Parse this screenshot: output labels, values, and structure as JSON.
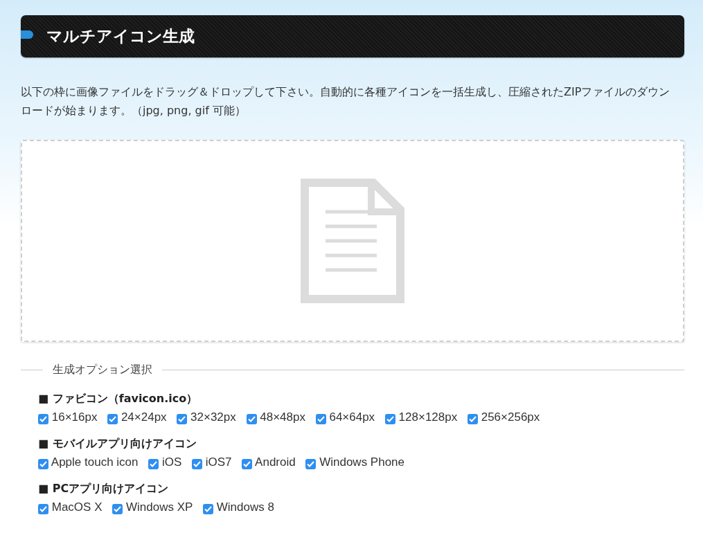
{
  "header": {
    "title": "マルチアイコン生成"
  },
  "description": "以下の枠に画像ファイルをドラッグ＆ドロップして下さい。自動的に各種アイコンを一括生成し、圧縮されたZIPファイルのダウンロードが始まります。（jpg, png, gif 可能）",
  "options_section": {
    "legend": "生成オプション選択",
    "groups": [
      {
        "title": "■ ファビコン（favicon.ico）",
        "options": [
          {
            "label": "16×16px",
            "checked": true
          },
          {
            "label": "24×24px",
            "checked": true
          },
          {
            "label": "32×32px",
            "checked": true
          },
          {
            "label": "48×48px",
            "checked": true
          },
          {
            "label": "64×64px",
            "checked": true
          },
          {
            "label": "128×128px",
            "checked": true
          },
          {
            "label": "256×256px",
            "checked": true
          }
        ]
      },
      {
        "title": "■ モバイルアプリ向けアイコン",
        "options": [
          {
            "label": "Apple touch icon",
            "checked": true
          },
          {
            "label": "iOS",
            "checked": true
          },
          {
            "label": "iOS7",
            "checked": true
          },
          {
            "label": "Android",
            "checked": true
          },
          {
            "label": "Windows Phone",
            "checked": true
          }
        ]
      },
      {
        "title": "■ PCアプリ向けアイコン",
        "options": [
          {
            "label": "MacOS X",
            "checked": true
          },
          {
            "label": "Windows XP",
            "checked": true
          },
          {
            "label": "Windows 8",
            "checked": true
          }
        ]
      }
    ]
  }
}
